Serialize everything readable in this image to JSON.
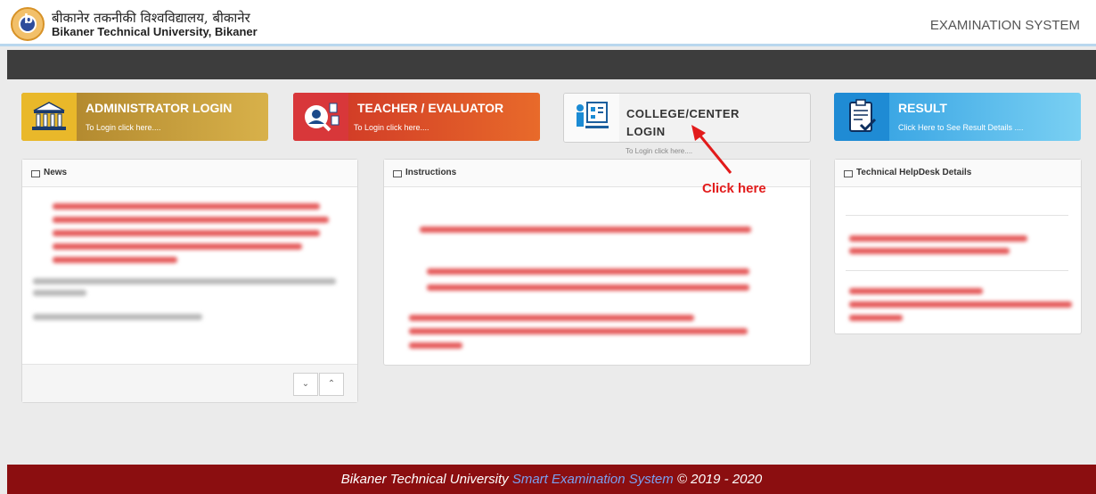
{
  "header": {
    "university_hindi": "बीकानेर तकनीकी विश्वविद्यालय, बीकानेर",
    "university_english": "Bikaner Technical University, Bikaner",
    "system_title": "EXAMINATION SYSTEM"
  },
  "cards": [
    {
      "title": "ADMINISTRATOR LOGIN",
      "subtitle": "To Login click here....",
      "icon": "building-icon",
      "color": "#c99a2e"
    },
    {
      "title": "TEACHER / EVALUATOR",
      "subtitle": "To Login click here....",
      "icon": "user-search-icon",
      "color": "#d33a2c"
    },
    {
      "title": "COLLEGE/CENTER LOGIN",
      "subtitle": "To Login click here....",
      "icon": "presentation-board-icon",
      "color": "#f2f2f2"
    },
    {
      "title": "RESULT",
      "subtitle": "Click Here to See Result Details ....",
      "icon": "clipboard-check-icon",
      "color": "#2a9be0"
    }
  ],
  "panels": {
    "news": "News",
    "instructions": "Instructions",
    "helpdesk": "Technical HelpDesk Details"
  },
  "annotation": {
    "text": "Click here"
  },
  "scroll": {
    "down": "⌄",
    "up": "⌃"
  },
  "footer": {
    "prefix": "Bikaner Technical University ",
    "highlight": "Smart Examination System",
    "suffix": " © 2019 - 2020"
  },
  "colors": {
    "footer_bg": "#8b0e10",
    "annotation": "#e21b1b",
    "dark_bar": "#3d3d3d"
  }
}
